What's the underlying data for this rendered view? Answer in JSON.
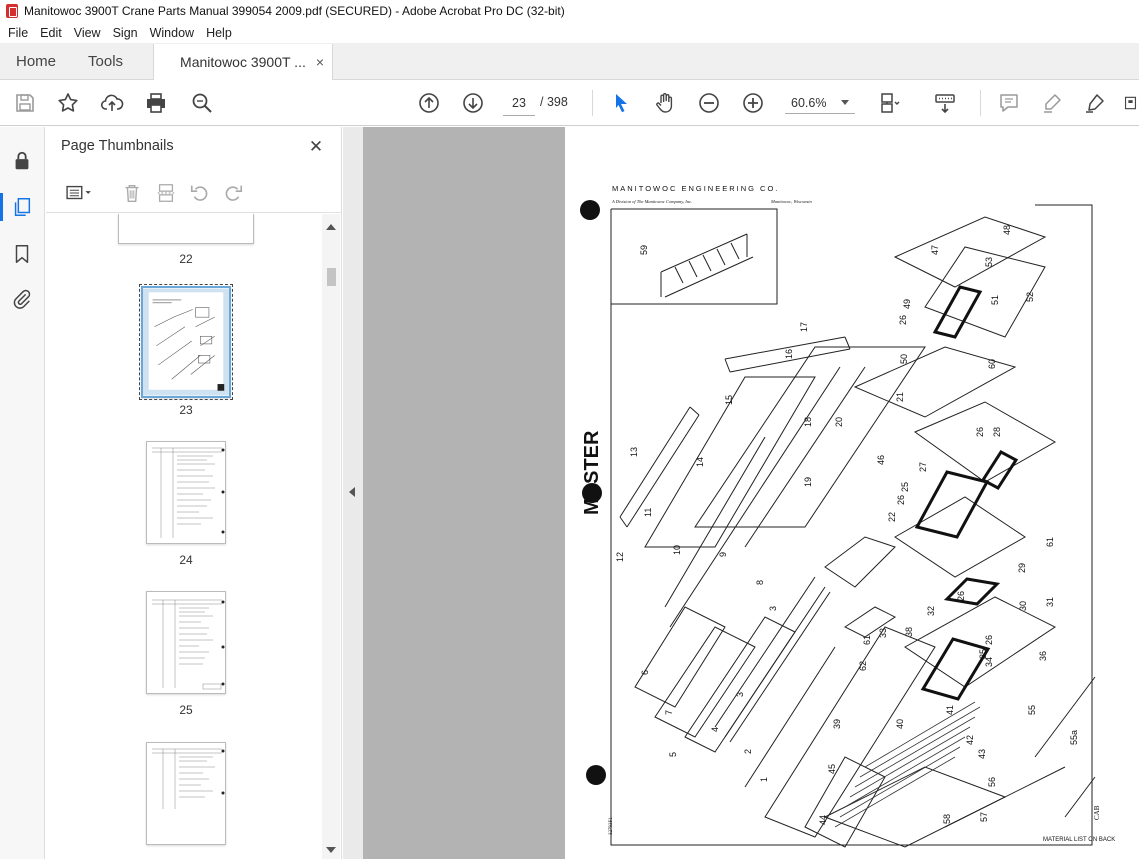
{
  "window": {
    "title": "Manitowoc 3900T Crane Parts Manual 399054 2009.pdf (SECURED) - Adobe Acrobat Pro DC (32-bit)"
  },
  "menu": [
    "File",
    "Edit",
    "View",
    "Sign",
    "Window",
    "Help"
  ],
  "tabs": {
    "home": "Home",
    "tools": "Tools",
    "document": "Manitowoc 3900T ...",
    "close_glyph": "×"
  },
  "toolbar": {
    "current_page": "23",
    "page_total": "/ 398",
    "zoom": "60.6%"
  },
  "thumbnails_panel": {
    "title": "Page Thumbnails",
    "close_glyph": "✕",
    "pages": [
      {
        "number": "22",
        "selected": false
      },
      {
        "number": "23",
        "selected": true
      },
      {
        "number": "24",
        "selected": false
      },
      {
        "number": "25",
        "selected": false
      }
    ]
  },
  "page_content": {
    "company": "MANITOWOC ENGINEERING CO.",
    "division": "A Division of The Manitowoc Company, Inc.",
    "location": "Manitowoc, Wisconsin",
    "watermark": "MASTER",
    "footer_note": "MATERIAL LIST ON BACK",
    "footer_code": "CAB",
    "drawing_number": "32793F1",
    "callouts": [
      "59",
      "48",
      "47",
      "53",
      "52",
      "49",
      "26",
      "51",
      "50",
      "60",
      "17",
      "16",
      "21",
      "15",
      "18",
      "20",
      "26",
      "28",
      "13",
      "14",
      "46",
      "27",
      "25",
      "26",
      "22",
      "19",
      "11",
      "61",
      "9",
      "12",
      "10",
      "29",
      "8",
      "26",
      "30",
      "31",
      "32",
      "3",
      "33",
      "38",
      "26",
      "35",
      "36",
      "6",
      "61",
      "62",
      "34",
      "7",
      "3",
      "41",
      "55",
      "4",
      "39",
      "40",
      "42",
      "2",
      "5",
      "43",
      "1",
      "45",
      "55a",
      "56",
      "44",
      "58",
      "57"
    ]
  },
  "colors": {
    "accent": "#1473e6",
    "viewer_bg": "#b3b3b3",
    "app_icon": "#d32f2f"
  }
}
